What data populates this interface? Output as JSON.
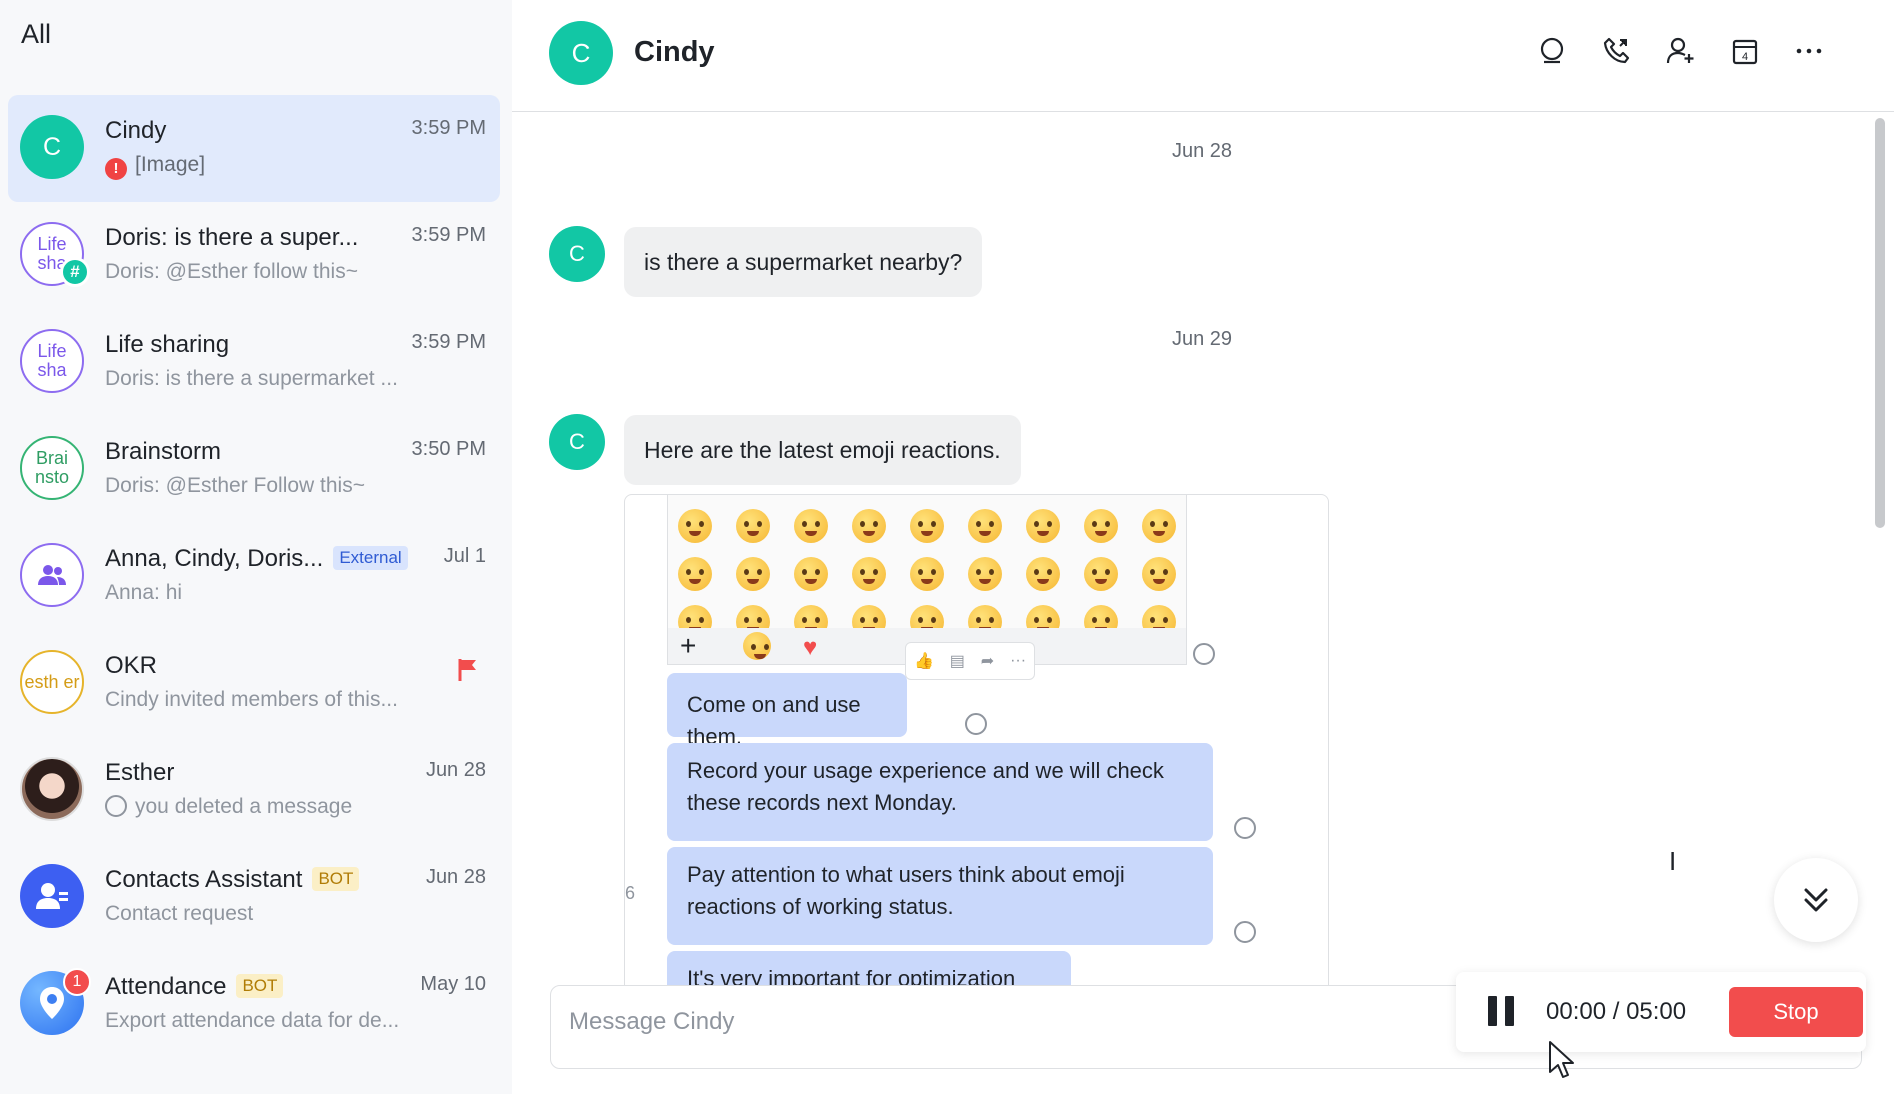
{
  "sidebar": {
    "title": "All",
    "conversations": [
      {
        "name": "Cindy",
        "time": "3:59 PM",
        "avatar_text": "C",
        "preview": "[Image]"
      },
      {
        "name": "Doris: is there a super...",
        "time": "3:59 PM",
        "avatar_text": "Life sha",
        "preview": "Doris: @Esther follow this~"
      },
      {
        "name": "Life sharing",
        "time": "3:59 PM",
        "avatar_text": "Life sha",
        "preview": "Doris: is there a supermarket ..."
      },
      {
        "name": "Brainstorm",
        "time": "3:50 PM",
        "avatar_text": "Brai nsto",
        "preview": "Doris: @Esther Follow this~"
      },
      {
        "name": "Anna, Cindy, Doris...",
        "tag": "External",
        "time": "Jul 1",
        "preview": "Anna: hi"
      },
      {
        "name": "OKR",
        "time": "",
        "avatar_text": "esth er",
        "preview": "Cindy invited members of this..."
      },
      {
        "name": "Esther",
        "time": "Jun 28",
        "preview": "you deleted a message"
      },
      {
        "name": "Contacts Assistant",
        "tag": "BOT",
        "time": "Jun 28",
        "preview": "Contact request"
      },
      {
        "name": "Attendance",
        "tag": "BOT",
        "time": "May 10",
        "preview": "Export attendance data for de...",
        "unread": "1"
      }
    ]
  },
  "header": {
    "avatar_text": "C",
    "title": "Cindy",
    "icons": [
      "search-icon",
      "phone-icon",
      "add-member-icon",
      "calendar-icon",
      "more-icon"
    ],
    "calendar_day": "4"
  },
  "messages": {
    "date_1": "Jun 28",
    "msg_1": "is there a supermarket nearby?",
    "date_2": "Jun 29",
    "msg_2": "Here are the latest emoji reactions.",
    "avatar_text": "C",
    "card": {
      "line_1": "Come on and use them.",
      "line_2": "Record your usage experience and we will check these records next Monday.",
      "line_3": "Pay attention to what users think about emoji reactions of working status.",
      "line_4": "It's very important for optimization",
      "left_fragment": "6"
    }
  },
  "composer": {
    "placeholder": "Message Cindy",
    "recording_time": "00:00 / 05:00",
    "stop_label": "Stop"
  },
  "colors": {
    "accent_teal": "#12c7a5",
    "active_bg": "#e1eafc",
    "bubble_blue": "#c9d8fb",
    "stop_red": "#f24d4d"
  }
}
